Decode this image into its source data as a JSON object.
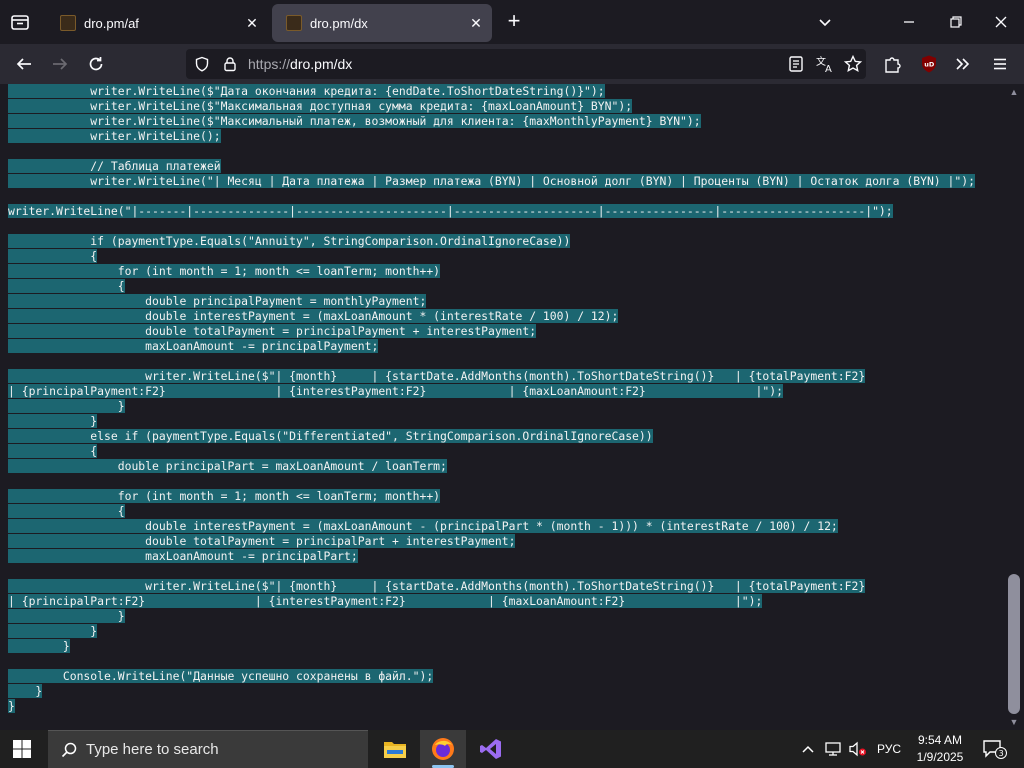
{
  "browser": {
    "tabs": [
      {
        "title": "dro.pm/af",
        "active": false
      },
      {
        "title": "dro.pm/dx",
        "active": true
      }
    ],
    "url_prefix": "https://",
    "url_host": "dro.pm/dx",
    "ublock_badge": "uD"
  },
  "code_lines": [
    {
      "text": "            writer.WriteLine($\"Дата окончания кредита: {endDate.ToShortDateString()}\");",
      "sel": true
    },
    {
      "text": "            writer.WriteLine($\"Максимальная доступная сумма кредита: {maxLoanAmount} BYN\");",
      "sel": true
    },
    {
      "text": "            writer.WriteLine($\"Максимальный платеж, возможный для клиента: {maxMonthlyPayment} BYN\");",
      "sel": true
    },
    {
      "text": "            writer.WriteLine();",
      "sel": true
    },
    {
      "text": "",
      "sel": false
    },
    {
      "text": "            // Таблица платежей",
      "sel": true
    },
    {
      "text": "            writer.WriteLine(\"| Месяц | Дата платежа | Размер платежа (BYN) | Основной долг (BYN) | Проценты (BYN) | Остаток долга (BYN) |\");",
      "sel": true
    },
    {
      "text": "",
      "sel": false
    },
    {
      "text": "writer.WriteLine(\"|-------|--------------|----------------------|---------------------|----------------|---------------------|\");",
      "sel": true
    },
    {
      "text": "",
      "sel": false
    },
    {
      "text": "            if (paymentType.Equals(\"Annuity\", StringComparison.OrdinalIgnoreCase))",
      "sel": true
    },
    {
      "text": "            {",
      "sel": true
    },
    {
      "text": "                for (int month = 1; month <= loanTerm; month++)",
      "sel": true
    },
    {
      "text": "                {",
      "sel": true
    },
    {
      "text": "                    double principalPayment = monthlyPayment;",
      "sel": true
    },
    {
      "text": "                    double interestPayment = (maxLoanAmount * (interestRate / 100) / 12);",
      "sel": true
    },
    {
      "text": "                    double totalPayment = principalPayment + interestPayment;",
      "sel": true
    },
    {
      "text": "                    maxLoanAmount -= principalPayment;",
      "sel": true
    },
    {
      "text": "",
      "sel": false
    },
    {
      "text": "                    writer.WriteLine($\"| {month}     | {startDate.AddMonths(month).ToShortDateString()}   | {totalPayment:F2}",
      "sel": true
    },
    {
      "text": "| {principalPayment:F2}                | {interestPayment:F2}            | {maxLoanAmount:F2}                |\");",
      "sel": true
    },
    {
      "text": "                }",
      "sel": true
    },
    {
      "text": "            }",
      "sel": true
    },
    {
      "text": "            else if (paymentType.Equals(\"Differentiated\", StringComparison.OrdinalIgnoreCase))",
      "sel": true
    },
    {
      "text": "            {",
      "sel": true
    },
    {
      "text": "                double principalPart = maxLoanAmount / loanTerm;",
      "sel": true
    },
    {
      "text": "",
      "sel": false
    },
    {
      "text": "                for (int month = 1; month <= loanTerm; month++)",
      "sel": true
    },
    {
      "text": "                {",
      "sel": true
    },
    {
      "text": "                    double interestPayment = (maxLoanAmount - (principalPart * (month - 1))) * (interestRate / 100) / 12;",
      "sel": true
    },
    {
      "text": "                    double totalPayment = principalPart + interestPayment;",
      "sel": true
    },
    {
      "text": "                    maxLoanAmount -= principalPart;",
      "sel": true
    },
    {
      "text": "",
      "sel": false
    },
    {
      "text": "                    writer.WriteLine($\"| {month}     | {startDate.AddMonths(month).ToShortDateString()}   | {totalPayment:F2}",
      "sel": true
    },
    {
      "text": "| {principalPart:F2}                | {interestPayment:F2}            | {maxLoanAmount:F2}                |\");",
      "sel": true
    },
    {
      "text": "                }",
      "sel": true
    },
    {
      "text": "            }",
      "sel": true
    },
    {
      "text": "        }",
      "sel": true
    },
    {
      "text": "",
      "sel": false
    },
    {
      "text": "        Console.WriteLine(\"Данные успешно сохранены в файл.\");",
      "sel": true
    },
    {
      "text": "    }",
      "sel": true
    },
    {
      "text": "}",
      "sel": true
    }
  ],
  "taskbar": {
    "search_placeholder": "Type here to search",
    "language": "РУС",
    "time": "9:54 AM",
    "date": "1/9/2025",
    "notification_count": "3"
  },
  "colors": {
    "selection": "#1c6671",
    "page_bg": "#1c1b22",
    "toolbar_bg": "#2b2a33"
  }
}
